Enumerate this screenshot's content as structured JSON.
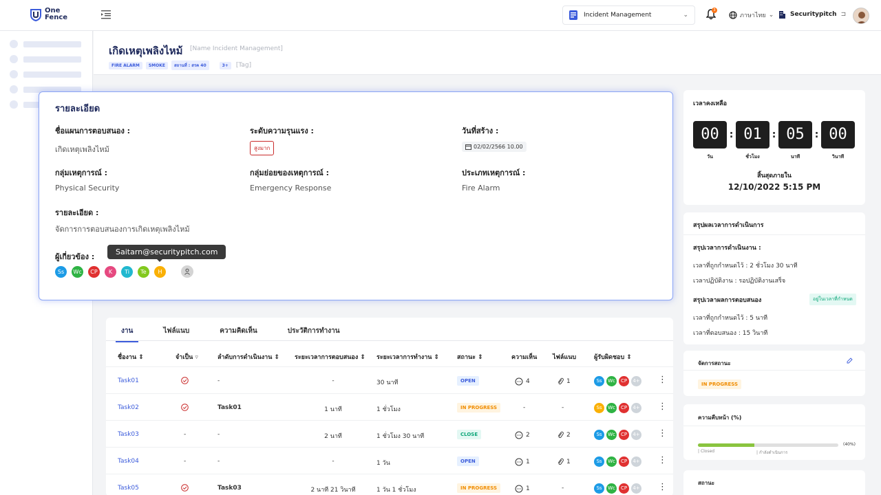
{
  "app": {
    "logo_line1": "One",
    "logo_line2": "Fence"
  },
  "topbar": {
    "incident_select": "Incident Management",
    "notification_count": "3",
    "language": "ภาษาไทย",
    "company": "Securitypitch"
  },
  "header": {
    "title": "เกิดเหตุเพลิงไหม้",
    "title_placeholder": "[Name Incident Management]",
    "tags": [
      "FIRE ALARM",
      "SMOKE",
      "สถานที่ : สรค 40"
    ],
    "more_tags": "3+",
    "tag_placeholder": "[Tag]"
  },
  "detail": {
    "title": "รายละเอียด",
    "plan_label": "ชื่อแผนการตอบสนอง :",
    "plan_value": "เกิดเหตุเพลิงไหม้",
    "severity_label": "ระดับความรุนแรง :",
    "severity_value": "สูงมาก",
    "created_label": "วันที่สร้าง :",
    "created_value": "02/02/2566 10.00",
    "group_label": "กลุ่มเหตุการณ์ :",
    "group_value": "Physical Security",
    "subgroup_label": "กลุ่มย่อยของเหตุการณ์ :",
    "subgroup_value": "Emergency Response",
    "type_label": "ประเภทเหตุการณ์ :",
    "type_value": "Fire Alarm",
    "description_label": "รายละเอียด :",
    "description_value": "จัดการการตอบสนองการเกิดเหตุเพลิงไหม้",
    "related_label": "ผู้เกี่ยวข้อง :",
    "tooltip": "Saitarn@securitypitch.com",
    "people": [
      {
        "initials": "Ss",
        "color": "#1c9be6"
      },
      {
        "initials": "Wc",
        "color": "#2fb344"
      },
      {
        "initials": "CP",
        "color": "#e03131"
      },
      {
        "initials": "K",
        "color": "#e64980"
      },
      {
        "initials": "Ti",
        "color": "#22b8cf"
      },
      {
        "initials": "Te",
        "color": "#82c91e"
      },
      {
        "initials": "H",
        "color": "#fab005"
      }
    ]
  },
  "tasks": {
    "tabs": [
      "งาน",
      "ไฟล์แนบ",
      "ความคิดเห็น",
      "ประวัติการทำงาน"
    ],
    "headers": {
      "name": "ชื่องาน ⇕",
      "required": "จำเป็น",
      "order": "ลำดับการดำเนินงาน ⇕",
      "response": "ระยะเวลาการตอบสนอง ⇕",
      "work": "ระยะเวลาการทำงาน ⇕",
      "status": "สถานะ ⇕",
      "comments": "ความเห็น",
      "files": "ไฟล์แนบ",
      "owners": "ผู้รับผิดชอบ ⇕"
    },
    "rows": [
      {
        "name": "Task01",
        "required": true,
        "order": "-",
        "response": "-",
        "work": "30 นาที",
        "status": "OPEN",
        "status_type": "open",
        "comments": "4",
        "files": "1",
        "owners_more": "4+"
      },
      {
        "name": "Task02",
        "required": true,
        "order": "Task01",
        "response": "1 นาที",
        "work": "1 ชั่วโมง",
        "status": "IN PROGRESS",
        "status_type": "prog",
        "comments": "-",
        "files": "-",
        "owners_more": "4+"
      },
      {
        "name": "Task03",
        "required": false,
        "order": "-",
        "response": "2 นาที",
        "work": "1 ชั่วโมง 30 นาที",
        "status": "CLOSE",
        "status_type": "close",
        "comments": "2",
        "files": "2",
        "owners_more": "4+"
      },
      {
        "name": "Task04",
        "required": false,
        "order": "-",
        "response": "-",
        "work": "1 วัน",
        "status": "OPEN",
        "status_type": "open",
        "comments": "1",
        "files": "1",
        "owners_more": "4+"
      },
      {
        "name": "Task05",
        "required": true,
        "order": "Task03",
        "response": "2 นาที 21 วินาที",
        "work": "1 วัน 1 ชั่วโมง",
        "status": "IN PROGRESS",
        "status_type": "prog",
        "comments": "1",
        "files": "-",
        "owners_more": "4+"
      }
    ],
    "row_owner_sets": [
      [
        "Ss",
        "Wc",
        "CP"
      ],
      [
        "Ss",
        "Wc",
        "CP"
      ],
      [
        "Ss",
        "Wc",
        "CP"
      ],
      [
        "Ss",
        "Wc",
        "CP"
      ],
      [
        "Ss",
        "Wc",
        "CP"
      ]
    ]
  },
  "countdown": {
    "title": "เวลาคงเหลือ",
    "days": "00",
    "hours": "01",
    "minutes": "05",
    "seconds": "00",
    "days_label": "วัน",
    "hours_label": "ชั่วโมง",
    "minutes_label": "นาที",
    "seconds_label": "วินาที",
    "deadline_label": "สิ้นสุดภายใน",
    "deadline_value": "12/10/2022 5:15 PM"
  },
  "summary": {
    "title": "สรุปผลเวลาการดำเนินการ",
    "work_title": "สรุปเวลาการดำเนินงาน :",
    "work_planned": "เวลาที่ถูกกำหนดไว้ :   2 ชั่วโมง 30 นาที",
    "work_actual": "เวลาปฏิบัติงาน :        รอปฏิบัติงานเสร็จ",
    "response_title": "สรุปเวลาผลการตอบสนอง",
    "response_badge": "อยู่ในเวลาที่กำหนด",
    "response_planned": "เวลาที่ถูกกำหนดไว้ :  5 นาที",
    "response_actual": "เวลาที่ตอบสนอง :    15 วินาที"
  },
  "status_manage": {
    "title": "จัดการสถานะ",
    "value": "IN PROGRESS"
  },
  "progress": {
    "title": "ความคืบหน้า (%)",
    "percent": 40,
    "percent_text": "(40%)",
    "left_label": "Closed",
    "right_label": "กำลังดำเนินการ"
  },
  "status_card": {
    "title": "สถานะ"
  }
}
